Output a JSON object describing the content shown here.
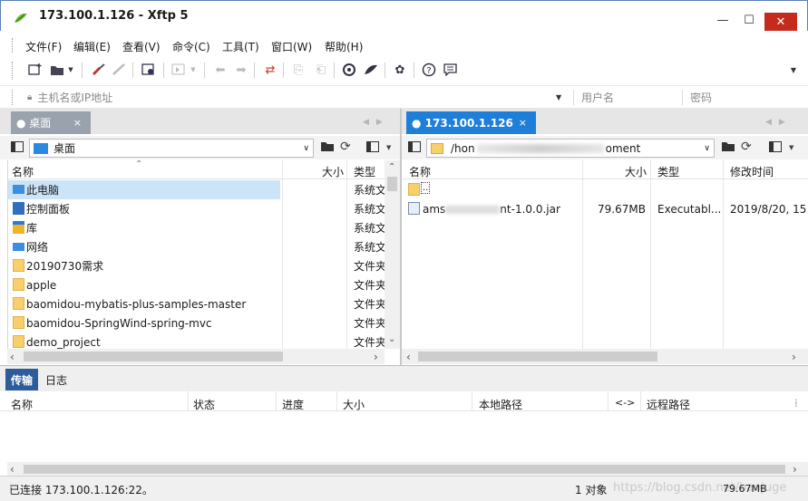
{
  "window": {
    "title": "173.100.1.126   - Xftp 5",
    "min_glyph": "—",
    "max_glyph": "☐",
    "close_glyph": "✕"
  },
  "menu": [
    "文件(F)",
    "编辑(E)",
    "查看(V)",
    "命令(C)",
    "工具(T)",
    "窗口(W)",
    "帮助(H)"
  ],
  "address": {
    "host_placeholder": "主机名或IP地址",
    "user_placeholder": "用户名",
    "password_placeholder": "密码"
  },
  "local": {
    "tab_label": "● 桌面",
    "tab_close": "×",
    "path": "桌面",
    "columns": {
      "name": "名称",
      "size": "大小",
      "type": "类型"
    },
    "rows": [
      {
        "name": "此电脑",
        "type": "系统文",
        "icon": "computer-icon"
      },
      {
        "name": "控制面板",
        "type": "系统文",
        "icon": "control-panel-icon"
      },
      {
        "name": "库",
        "type": "系统文",
        "icon": "library-icon"
      },
      {
        "name": "网络",
        "type": "系统文",
        "icon": "network-icon"
      },
      {
        "name": "20190730需求",
        "type": "文件夹",
        "icon": "folder-icon"
      },
      {
        "name": "apple",
        "type": "文件夹",
        "icon": "folder-icon"
      },
      {
        "name": "baomidou-mybatis-plus-samples-master",
        "type": "文件夹",
        "icon": "folder-icon"
      },
      {
        "name": "baomidou-SpringWind-spring-mvc",
        "type": "文件夹",
        "icon": "folder-icon"
      },
      {
        "name": "demo_project",
        "type": "文件夹",
        "icon": "folder-icon"
      }
    ]
  },
  "remote": {
    "tab_label": "● 173.100.1.126",
    "tab_close": "×",
    "path_start": "/hon",
    "path_end": "oment",
    "columns": {
      "name": "名称",
      "size": "大小",
      "type": "类型",
      "modified": "修改时间"
    },
    "rows": [
      {
        "name": "..",
        "size": "",
        "type": "",
        "modified": "",
        "icon": "folder-icon"
      },
      {
        "name_start": "ams",
        "name_end": "nt-1.0.0.jar",
        "size": "79.67MB",
        "type": "Executabl...",
        "modified": "2019/8/20, 15",
        "icon": "jar-file-icon"
      }
    ]
  },
  "transfer": {
    "tabs": [
      "传输",
      "日志"
    ],
    "columns": [
      "名称",
      "状态",
      "进度",
      "大小",
      "本地路径",
      "<->",
      "远程路径"
    ]
  },
  "status": {
    "connection": "已连接 173.100.1.126:22。",
    "objects": "1 对象",
    "watermark": "https://blog.csdn.net/baojuge",
    "size": "79.67MB"
  },
  "colors": {
    "accent": "#1f7fd8",
    "close": "#c42b1c",
    "transfer_tab": "#2d5c9a"
  }
}
